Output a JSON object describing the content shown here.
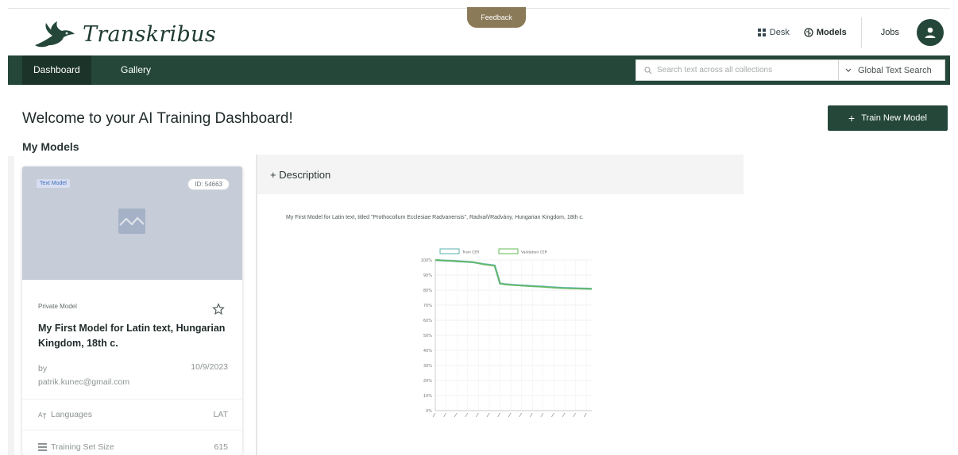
{
  "header": {
    "brand": "Transkribus",
    "feedback": "Feedback",
    "links": {
      "desk": "Desk",
      "models": "Models",
      "jobs": "Jobs"
    }
  },
  "nav": {
    "tabs": [
      {
        "label": "Dashboard",
        "active": true
      },
      {
        "label": "Gallery",
        "active": false
      }
    ],
    "search": {
      "placeholder": "Search text across all collections",
      "scope": "Global Text Search"
    }
  },
  "main": {
    "title": "Welcome to your AI Training Dashboard!",
    "train_button": "Train New Model",
    "section_title": "My Models"
  },
  "model_card": {
    "type": "Text Model",
    "id": "ID: 54663",
    "visibility": "Private Model",
    "title": "My First Model for Latin text, Hungarian Kingdom, 18th c.",
    "by_label": "by",
    "author": "patrik.kunec@gmail.com",
    "date": "10/9/2023",
    "rows": [
      {
        "label": "Languages",
        "value": "LAT",
        "icon": "languages-icon"
      },
      {
        "label": "Training Set Size",
        "value": "615",
        "icon": "training-set-icon"
      }
    ]
  },
  "detail": {
    "description_label": "+ Description",
    "description_text": "My First Model for Latin text, titled \"Prothocollum Ecclesiae Radvanensis\", Radvaň/Radvány, Hungarian Kingdom, 18th c."
  },
  "chart_data": {
    "type": "line",
    "series": [
      {
        "name": "Train CER",
        "color": "#5bb0ad",
        "values": [
          100,
          99.8,
          99.6,
          99.4,
          99.2,
          99,
          98.8,
          98.5,
          97.9,
          97.2,
          96.8,
          96.3,
          84.5,
          83.9,
          83.6,
          83.3,
          83.1,
          82.9,
          82.7,
          82.5,
          82.3,
          82,
          81.8,
          81.6,
          81.4,
          81.3,
          81.2,
          81.1,
          81,
          80.9
        ]
      },
      {
        "name": "Validation CER",
        "color": "#66bb55",
        "values": [
          100,
          99.8,
          99.6,
          99.4,
          99.2,
          99,
          98.8,
          98.5,
          97.8,
          97.1,
          96.6,
          96.1,
          84.2,
          83.7,
          83.4,
          83.1,
          82.9,
          82.7,
          82.5,
          82.3,
          82.1,
          81.8,
          81.6,
          81.4,
          81.2,
          81.1,
          81,
          80.9,
          80.8,
          80.7
        ]
      }
    ],
    "y_ticks": [
      "100%",
      "90%",
      "80%",
      "70%",
      "60%",
      "50%",
      "40%",
      "30%",
      "20%",
      "10%",
      "0%"
    ],
    "ylim": [
      0,
      100
    ],
    "grid": true,
    "legend": "top"
  }
}
